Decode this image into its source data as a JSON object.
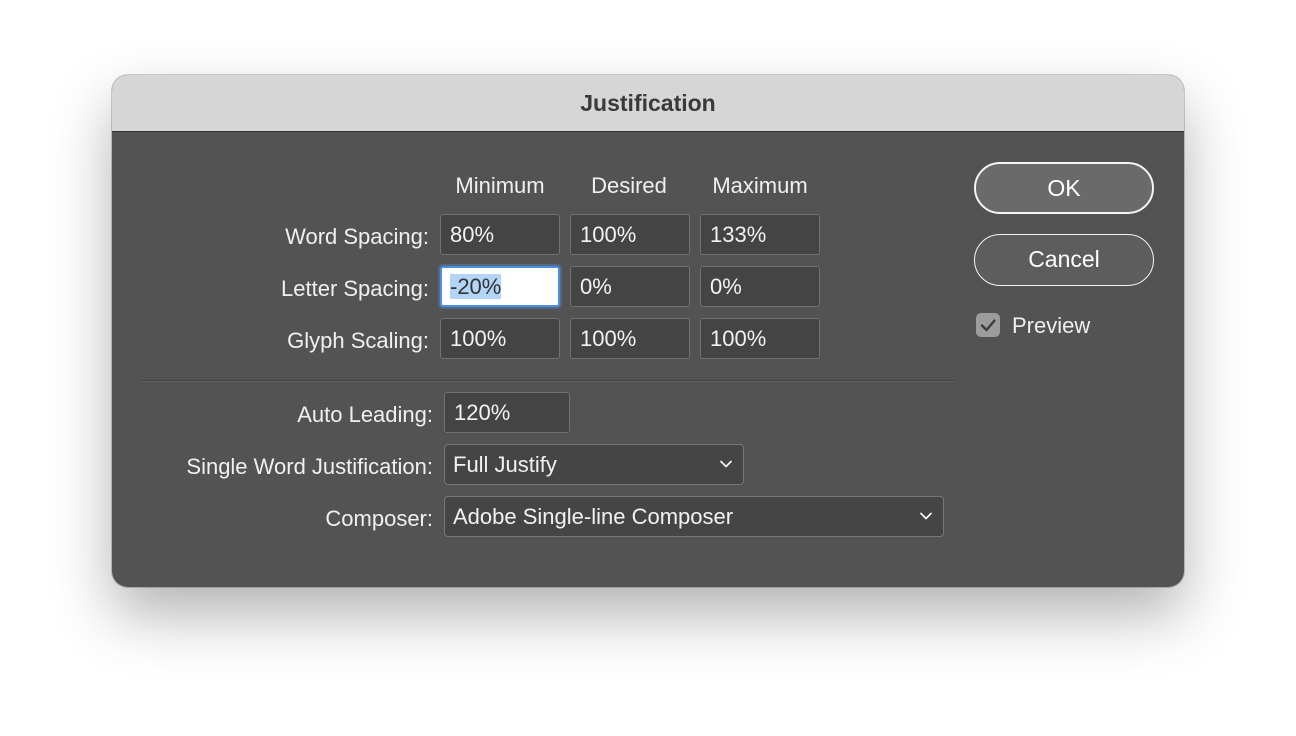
{
  "dialog": {
    "title": "Justification"
  },
  "columns": {
    "minimum": "Minimum",
    "desired": "Desired",
    "maximum": "Maximum"
  },
  "rows": {
    "word_spacing": {
      "label": "Word Spacing:",
      "min": "80%",
      "desired": "100%",
      "max": "133%"
    },
    "letter_spacing": {
      "label": "Letter Spacing:",
      "min": "-20%",
      "desired": "0%",
      "max": "0%"
    },
    "glyph_scaling": {
      "label": "Glyph Scaling:",
      "min": "100%",
      "desired": "100%",
      "max": "100%"
    }
  },
  "auto_leading": {
    "label": "Auto Leading:",
    "value": "120%"
  },
  "single_word": {
    "label": "Single Word Justification:",
    "value": "Full Justify"
  },
  "composer": {
    "label": "Composer:",
    "value": "Adobe Single-line Composer"
  },
  "buttons": {
    "ok": "OK",
    "cancel": "Cancel"
  },
  "preview": {
    "label": "Preview",
    "checked": true
  },
  "icons": {
    "dropdown": "chevron-down-icon",
    "check": "checkmark-icon"
  },
  "colors": {
    "dialog_bg": "#535353",
    "titlebar_bg": "#d6d6d6",
    "focus_ring": "#4f8fe0",
    "selection": "#b3d3f7"
  }
}
